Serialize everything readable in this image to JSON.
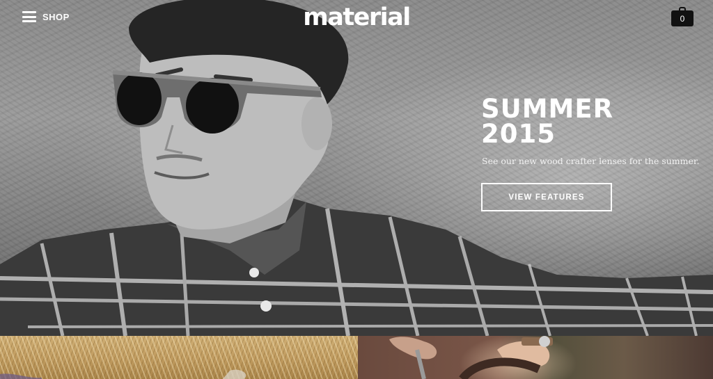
{
  "header": {
    "menu_label": "SHOP",
    "logo_text": "material",
    "cart_count": "0"
  },
  "hero": {
    "title_line1": "SUMMER",
    "title_line2": "2015",
    "subtitle": "See our new wood crafter lenses for the summer.",
    "cta_label": "VIEW FEATURES",
    "image_description": "black and white photo of man in wooden sunglasses and plaid shirt"
  },
  "tiles": [
    {
      "name": "hay-field-tile"
    },
    {
      "name": "bicycle-rider-tile"
    }
  ],
  "colors": {
    "text": "#ffffff",
    "cart_badge": "#111111",
    "tile_left": "#c6a468",
    "tile_right": "#6e5044"
  },
  "icons": {
    "menu": "hamburger-menu-icon",
    "cart": "shopping-bag-icon"
  }
}
